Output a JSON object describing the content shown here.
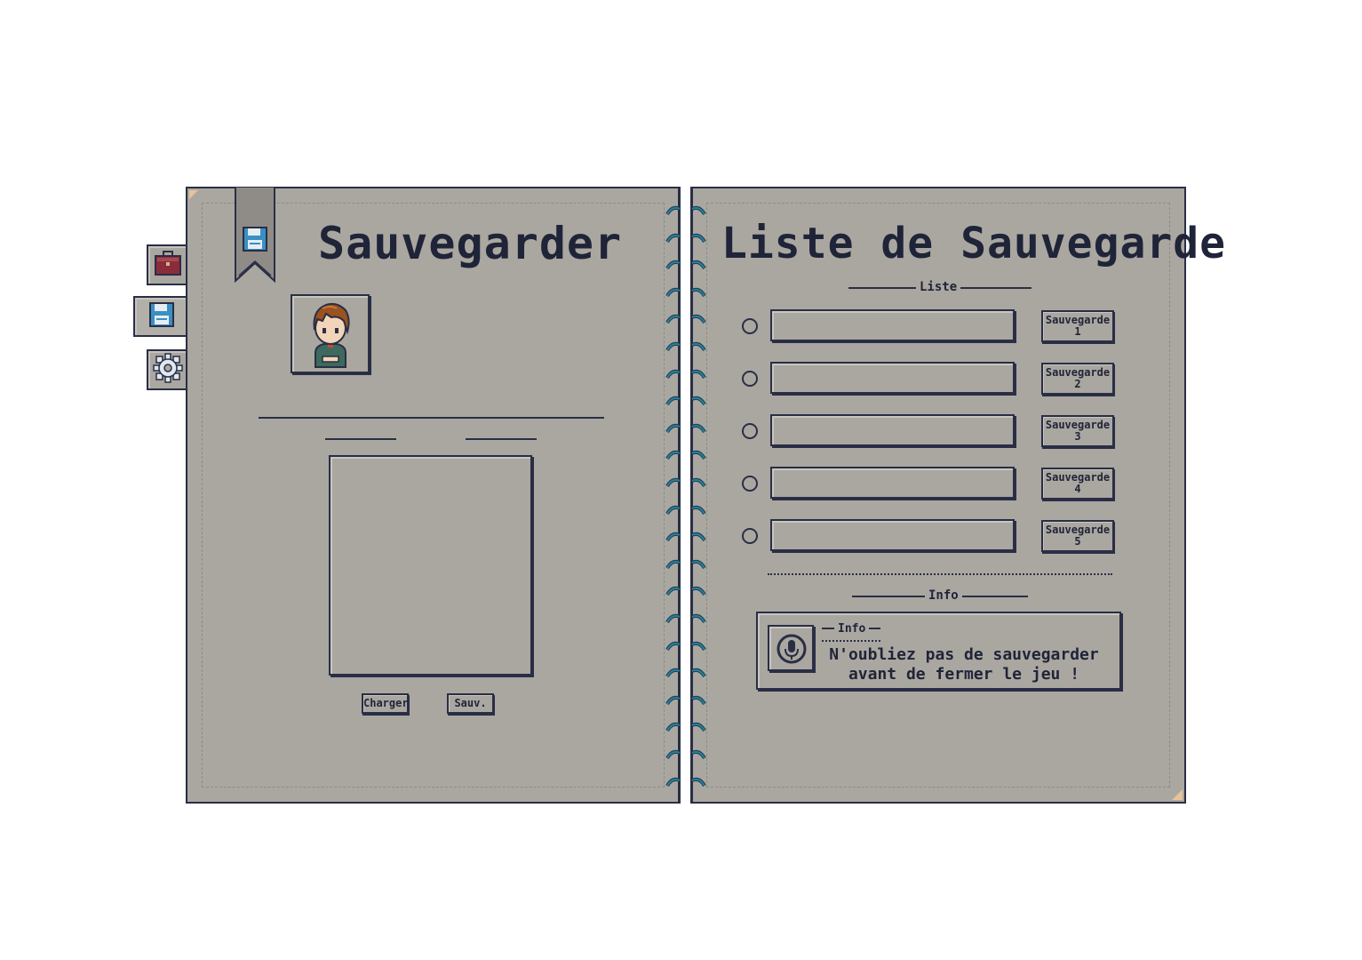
{
  "left_page": {
    "title": "Sauvegarder",
    "buttons": {
      "load": "Charger",
      "save": "Sauv."
    }
  },
  "right_page": {
    "title": "Liste de Sauvegarde",
    "list_section_label": "Liste",
    "info_section_label": "Info",
    "slots": [
      {
        "button_line1": "Sauvegarde",
        "button_line2": "1"
      },
      {
        "button_line1": "Sauvegarde",
        "button_line2": "2"
      },
      {
        "button_line1": "Sauvegarde",
        "button_line2": "3"
      },
      {
        "button_line1": "Sauvegarde",
        "button_line2": "4"
      },
      {
        "button_line1": "Sauvegarde",
        "button_line2": "5"
      }
    ],
    "info_box": {
      "label": "Info",
      "message_line1": "N'oubliez pas de sauvegarder",
      "message_line2": "avant de fermer le jeu !"
    }
  },
  "side_tabs": [
    {
      "icon": "briefcase-icon"
    },
    {
      "icon": "floppy-disk-icon"
    },
    {
      "icon": "gear-icon"
    }
  ],
  "colors": {
    "paper": "#aaa7a1",
    "ink": "#1f2438",
    "ring": "#2c7f9a",
    "bag": "#8a2d3a",
    "floppy": "#3a8fc4"
  }
}
